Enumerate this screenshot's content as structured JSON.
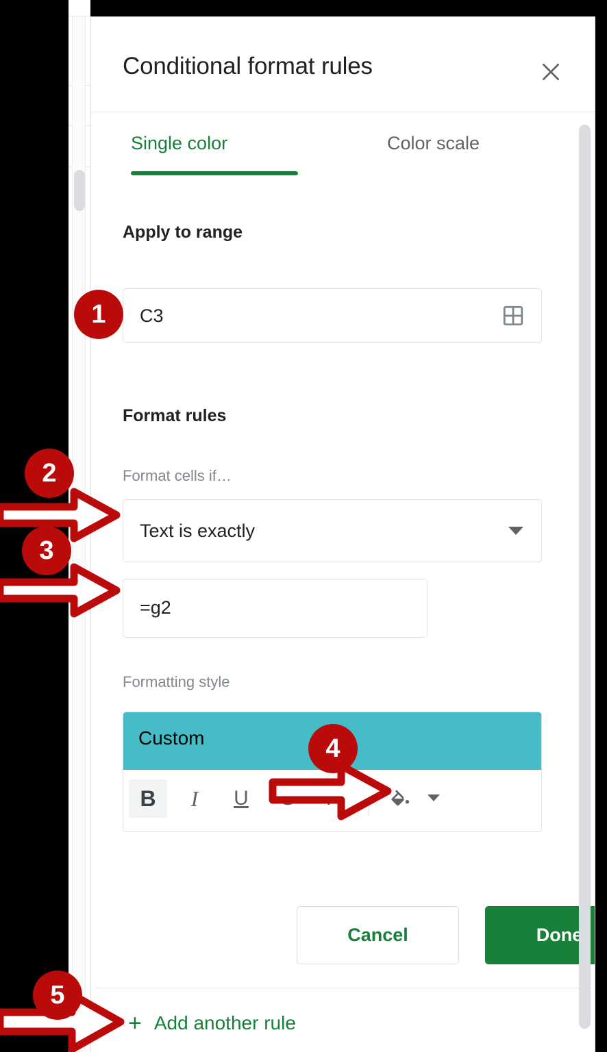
{
  "dialog": {
    "title": "Conditional format rules",
    "close_icon": "close-icon",
    "tabs": [
      {
        "label": "Single color",
        "active": true
      },
      {
        "label": "Color scale",
        "active": false
      }
    ],
    "apply_to_range": {
      "heading": "Apply to range",
      "value": "C3",
      "picker_icon": "grid-select-icon"
    },
    "format_rules": {
      "heading": "Format rules",
      "condition_label": "Format cells if…",
      "condition_value": "Text is exactly",
      "condition_caret_icon": "chevron-down-icon",
      "condition_input_value": "=g2"
    },
    "formatting_style": {
      "heading": "Formatting style",
      "preview_text": "Custom",
      "preview_fill_color": "#46bdc6",
      "toolbar": [
        {
          "name": "bold",
          "glyph": "B",
          "active": true
        },
        {
          "name": "italic",
          "glyph": "I",
          "active": false
        },
        {
          "name": "underline",
          "glyph": "U",
          "active": false
        },
        {
          "name": "strikethrough",
          "glyph": "S",
          "active": false
        },
        {
          "name": "text-color",
          "glyph": "A",
          "active": false
        },
        {
          "name": "fill-color",
          "glyph": "fill-bucket-icon",
          "active": false
        }
      ]
    },
    "actions": {
      "cancel_label": "Cancel",
      "done_label": "Done"
    },
    "add_rule": {
      "plus": "+",
      "label": "Add another rule"
    }
  },
  "annotations": {
    "markers": [
      {
        "number": "1"
      },
      {
        "number": "2"
      },
      {
        "number": "3"
      },
      {
        "number": "4"
      },
      {
        "number": "5"
      }
    ],
    "color": "#bb0a0a"
  },
  "colors": {
    "accent_green": "#188038",
    "preview_teal": "#46bdc6",
    "annotation_red": "#bb0a0a",
    "text_primary": "#202124",
    "text_secondary": "#80868b"
  }
}
